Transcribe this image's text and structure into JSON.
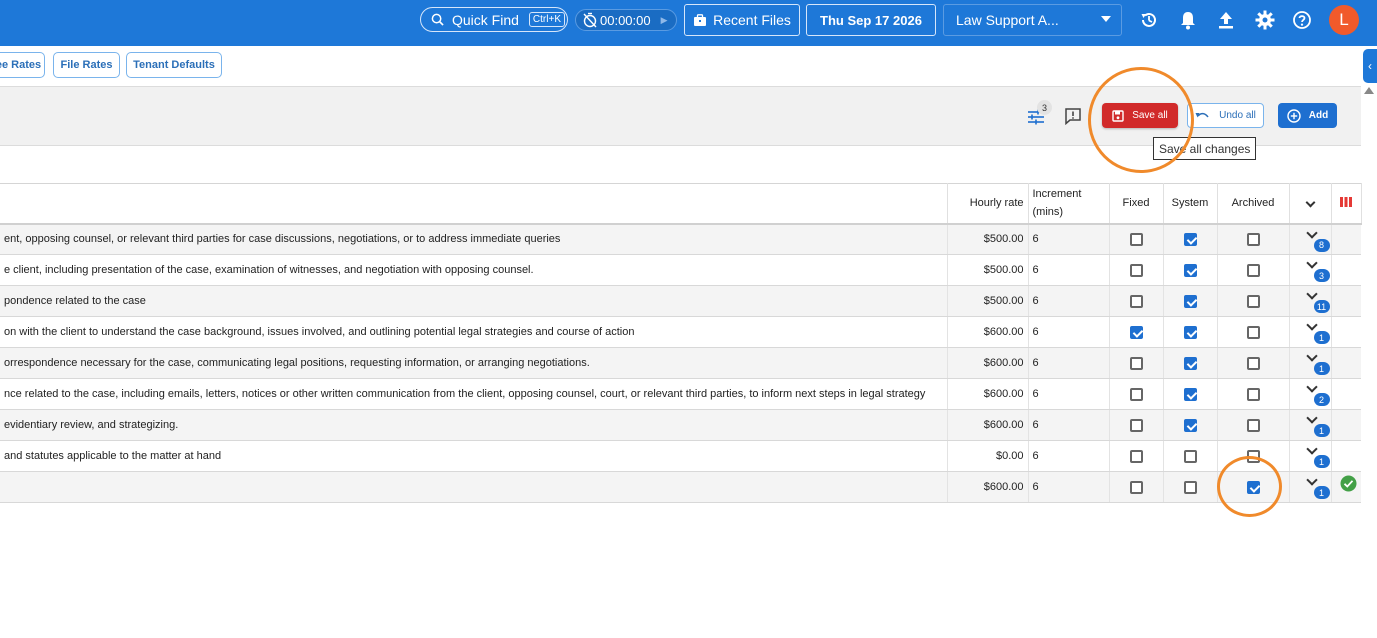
{
  "header": {
    "quick_find": "Quick Find",
    "shortcut": "Ctrl+K",
    "timer": "00:00:00",
    "recent_files": "Recent Files",
    "date": "Thu Sep 17 2026",
    "tenant": "Law Support A...",
    "avatar_initial": "L"
  },
  "rate_tabs": [
    "ee Rates",
    "File Rates",
    "Tenant Defaults"
  ],
  "toolbar": {
    "filter_count": "3",
    "save_all": "Save all",
    "undo_all": "Undo all",
    "add": "Add",
    "tooltip": "Save all changes"
  },
  "table": {
    "columns": {
      "hourly_rate": "Hourly rate",
      "increment": "Increment\n(mins)",
      "fixed": "Fixed",
      "system": "System",
      "archived": "Archived"
    },
    "rows": [
      {
        "desc": "ent, opposing counsel, or relevant third parties for case discussions, negotiations, or to address immediate queries",
        "rate": "$500.00",
        "inc": "6",
        "fixed": false,
        "system": true,
        "archived": false,
        "count": "8",
        "saved": false
      },
      {
        "desc": "e client, including presentation of the case, examination of witnesses, and negotiation with opposing counsel.",
        "rate": "$500.00",
        "inc": "6",
        "fixed": false,
        "system": true,
        "archived": false,
        "count": "3",
        "saved": false
      },
      {
        "desc": "pondence related to the case",
        "rate": "$500.00",
        "inc": "6",
        "fixed": false,
        "system": true,
        "archived": false,
        "count": "11",
        "saved": false
      },
      {
        "desc": "on with the client to understand the case background, issues involved, and outlining potential legal strategies and course of action",
        "rate": "$600.00",
        "inc": "6",
        "fixed": true,
        "system": true,
        "archived": false,
        "count": "1",
        "saved": false
      },
      {
        "desc": "orrespondence necessary for the case, communicating legal positions, requesting information, or arranging negotiations.",
        "rate": "$600.00",
        "inc": "6",
        "fixed": false,
        "system": true,
        "archived": false,
        "count": "1",
        "saved": false
      },
      {
        "desc": "nce related to the case, including emails, letters, notices or other written communication from the client, opposing counsel, court, or relevant third parties, to inform next steps in legal strategy",
        "rate": "$600.00",
        "inc": "6",
        "fixed": false,
        "system": true,
        "archived": false,
        "count": "2",
        "saved": false
      },
      {
        "desc": "evidentiary review, and strategizing.",
        "rate": "$600.00",
        "inc": "6",
        "fixed": false,
        "system": true,
        "archived": false,
        "count": "1",
        "saved": false
      },
      {
        "desc": "and statutes applicable to the matter at hand",
        "rate": "$0.00",
        "inc": "6",
        "fixed": false,
        "system": false,
        "archived": false,
        "count": "1",
        "saved": false
      },
      {
        "desc": "",
        "rate": "$600.00",
        "inc": "6",
        "fixed": false,
        "system": false,
        "archived": true,
        "count": "1",
        "saved": true
      }
    ]
  },
  "colors": {
    "brand": "#1e78d8",
    "save": "#d12a2a",
    "highlight": "#f08a2b",
    "success": "#43a047"
  }
}
